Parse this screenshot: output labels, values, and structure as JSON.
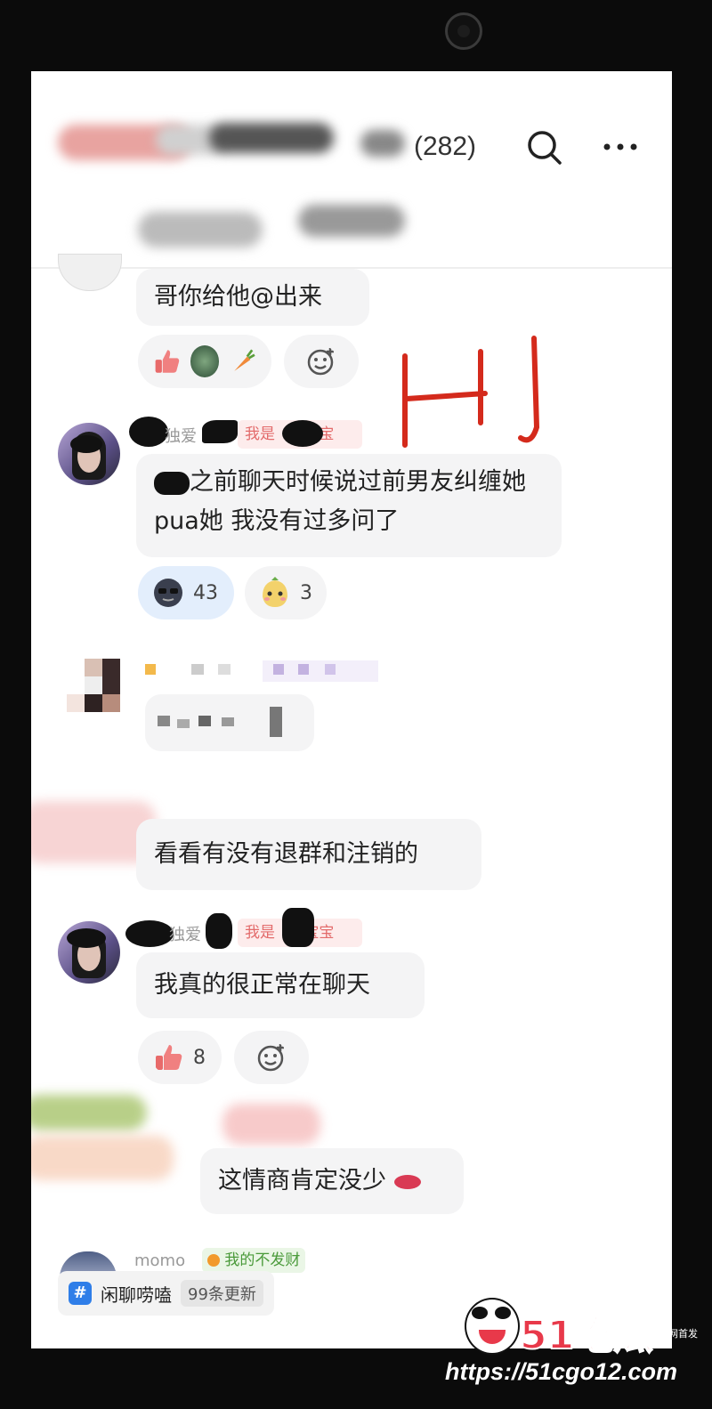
{
  "header": {
    "member_count": "(282)",
    "search_icon": "search-icon",
    "more_icon": "more-icon"
  },
  "messages": [
    {
      "text": "哥你给他@出来"
    },
    {
      "text": "之前聊天时候说过前男友纠缠她 pua她 我没有过多问了",
      "sender_partial": "独爱",
      "badge_partial": "我是",
      "badge_tail": "宝宝"
    },
    {
      "text": "看看有没有退群和注销的"
    },
    {
      "text": "我真的很正常在聊天",
      "sender_partial": "独爱",
      "badge_partial": "我是",
      "badge_tail": "宝宝"
    },
    {
      "text": "这情商肯定没少"
    }
  ],
  "reactions": {
    "msg1": [
      {
        "icon": "thumbs-up-icon"
      },
      {
        "icon": "carrot-icon"
      },
      {
        "icon": "add-reaction-icon"
      }
    ],
    "msg2": [
      {
        "icon": "sunglasses-emoji-icon",
        "count": "43",
        "color": "#e3eefc"
      },
      {
        "icon": "blushing-emoji-icon",
        "count": "3"
      }
    ],
    "msg4": [
      {
        "icon": "thumbs-up-icon",
        "count": "8"
      },
      {
        "icon": "add-reaction-icon"
      }
    ]
  },
  "handwriting": {
    "text": "HJ",
    "color": "#d42a1c"
  },
  "last_user": {
    "name": "momo",
    "badge": "我的不发财"
  },
  "bottom_bar": {
    "channel": "闲聊唠嗑",
    "updates": "99条更新"
  },
  "watermark": {
    "logo": "51吃瓜",
    "tag": "全网首发",
    "url": "https://51cgo12.com"
  }
}
